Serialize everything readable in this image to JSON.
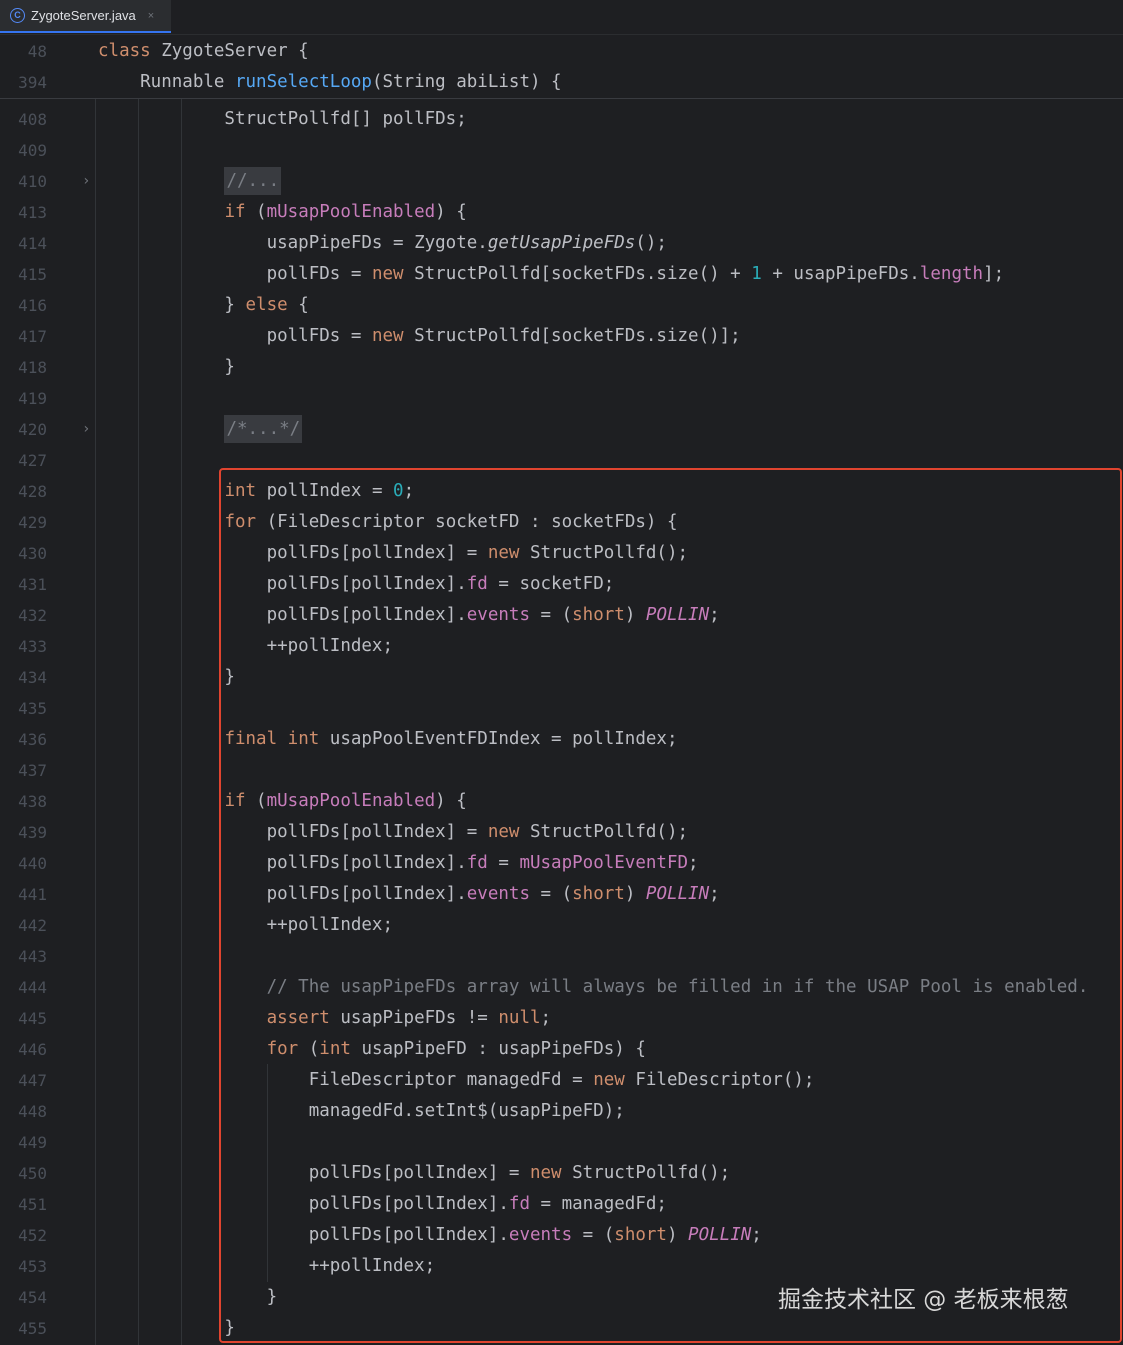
{
  "tab": {
    "icon": "C",
    "title": "ZygoteServer.java",
    "close": "×"
  },
  "sticky": [
    {
      "ln": "48",
      "tokens": [
        {
          "t": "class ",
          "c": "kw"
        },
        {
          "t": "ZygoteServer {"
        }
      ]
    },
    {
      "ln": "394",
      "tokens": [
        {
          "t": "    Runnable "
        },
        {
          "t": "runSelectLoop",
          "c": "fn"
        },
        {
          "t": "(String abiList) {"
        }
      ]
    }
  ],
  "lines": [
    {
      "ln": "408",
      "tokens": [
        {
          "t": "            StructPollfd[] pollFDs;"
        }
      ]
    },
    {
      "ln": "409",
      "tokens": []
    },
    {
      "ln": "410",
      "fold": true,
      "tokens": [
        {
          "t": "            "
        },
        {
          "t": "//...",
          "c": "cm fold-box"
        }
      ]
    },
    {
      "ln": "413",
      "tokens": [
        {
          "t": "            "
        },
        {
          "t": "if ",
          "c": "kw"
        },
        {
          "t": "("
        },
        {
          "t": "mUsapPoolEnabled",
          "c": "fld"
        },
        {
          "t": ") {"
        }
      ]
    },
    {
      "ln": "414",
      "tokens": [
        {
          "t": "                usapPipeFDs = Zygote."
        },
        {
          "t": "getUsapPipeFDs",
          "c": "mi"
        },
        {
          "t": "();"
        }
      ]
    },
    {
      "ln": "415",
      "tokens": [
        {
          "t": "                pollFDs = "
        },
        {
          "t": "new ",
          "c": "kw"
        },
        {
          "t": "StructPollfd[socketFDs.size() + "
        },
        {
          "t": "1",
          "c": "num"
        },
        {
          "t": " + usapPipeFDs."
        },
        {
          "t": "length",
          "c": "fld"
        },
        {
          "t": "];"
        }
      ]
    },
    {
      "ln": "416",
      "tokens": [
        {
          "t": "            } "
        },
        {
          "t": "else ",
          "c": "kw"
        },
        {
          "t": "{"
        }
      ]
    },
    {
      "ln": "417",
      "tokens": [
        {
          "t": "                pollFDs = "
        },
        {
          "t": "new ",
          "c": "kw"
        },
        {
          "t": "StructPollfd[socketFDs.size()];"
        }
      ]
    },
    {
      "ln": "418",
      "tokens": [
        {
          "t": "            }"
        }
      ]
    },
    {
      "ln": "419",
      "tokens": []
    },
    {
      "ln": "420",
      "fold": true,
      "tokens": [
        {
          "t": "            "
        },
        {
          "t": "/*...*/",
          "c": "cm fold-box"
        }
      ]
    },
    {
      "ln": "427",
      "tokens": []
    },
    {
      "ln": "428",
      "tokens": [
        {
          "t": "            "
        },
        {
          "t": "int ",
          "c": "kw"
        },
        {
          "t": "pollIndex = "
        },
        {
          "t": "0",
          "c": "num"
        },
        {
          "t": ";"
        }
      ]
    },
    {
      "ln": "429",
      "tokens": [
        {
          "t": "            "
        },
        {
          "t": "for ",
          "c": "kw"
        },
        {
          "t": "(FileDescriptor socketFD : socketFDs) {"
        }
      ]
    },
    {
      "ln": "430",
      "tokens": [
        {
          "t": "                pollFDs[pollIndex] = "
        },
        {
          "t": "new ",
          "c": "kw"
        },
        {
          "t": "StructPollfd();"
        }
      ]
    },
    {
      "ln": "431",
      "tokens": [
        {
          "t": "                pollFDs[pollIndex]."
        },
        {
          "t": "fd",
          "c": "fld"
        },
        {
          "t": " = socketFD;"
        }
      ]
    },
    {
      "ln": "432",
      "tokens": [
        {
          "t": "                pollFDs[pollIndex]."
        },
        {
          "t": "events",
          "c": "fld"
        },
        {
          "t": " = ("
        },
        {
          "t": "short",
          "c": "kw"
        },
        {
          "t": ") "
        },
        {
          "t": "POLLIN",
          "c": "fldi"
        },
        {
          "t": ";"
        }
      ]
    },
    {
      "ln": "433",
      "tokens": [
        {
          "t": "                ++pollIndex;"
        }
      ]
    },
    {
      "ln": "434",
      "tokens": [
        {
          "t": "            }"
        }
      ]
    },
    {
      "ln": "435",
      "tokens": []
    },
    {
      "ln": "436",
      "tokens": [
        {
          "t": "            "
        },
        {
          "t": "final int ",
          "c": "kw"
        },
        {
          "t": "usapPoolEventFDIndex = pollIndex;"
        }
      ]
    },
    {
      "ln": "437",
      "tokens": []
    },
    {
      "ln": "438",
      "tokens": [
        {
          "t": "            "
        },
        {
          "t": "if ",
          "c": "kw"
        },
        {
          "t": "("
        },
        {
          "t": "mUsapPoolEnabled",
          "c": "fld"
        },
        {
          "t": ") {"
        }
      ]
    },
    {
      "ln": "439",
      "tokens": [
        {
          "t": "                pollFDs[pollIndex] = "
        },
        {
          "t": "new ",
          "c": "kw"
        },
        {
          "t": "StructPollfd();"
        }
      ]
    },
    {
      "ln": "440",
      "tokens": [
        {
          "t": "                pollFDs[pollIndex]."
        },
        {
          "t": "fd",
          "c": "fld"
        },
        {
          "t": " = "
        },
        {
          "t": "mUsapPoolEventFD",
          "c": "fld"
        },
        {
          "t": ";"
        }
      ]
    },
    {
      "ln": "441",
      "tokens": [
        {
          "t": "                pollFDs[pollIndex]."
        },
        {
          "t": "events",
          "c": "fld"
        },
        {
          "t": " = ("
        },
        {
          "t": "short",
          "c": "kw"
        },
        {
          "t": ") "
        },
        {
          "t": "POLLIN",
          "c": "fldi"
        },
        {
          "t": ";"
        }
      ]
    },
    {
      "ln": "442",
      "tokens": [
        {
          "t": "                ++pollIndex;"
        }
      ]
    },
    {
      "ln": "443",
      "tokens": []
    },
    {
      "ln": "444",
      "tokens": [
        {
          "t": "                "
        },
        {
          "t": "// The usapPipeFDs array will always be filled in if the USAP Pool is enabled.",
          "c": "cm"
        }
      ]
    },
    {
      "ln": "445",
      "tokens": [
        {
          "t": "                "
        },
        {
          "t": "assert ",
          "c": "kw"
        },
        {
          "t": "usapPipeFDs != "
        },
        {
          "t": "null",
          "c": "kw"
        },
        {
          "t": ";"
        }
      ]
    },
    {
      "ln": "446",
      "tokens": [
        {
          "t": "                "
        },
        {
          "t": "for ",
          "c": "kw"
        },
        {
          "t": "("
        },
        {
          "t": "int ",
          "c": "kw"
        },
        {
          "t": "usapPipeFD : usapPipeFDs) {"
        }
      ]
    },
    {
      "ln": "447",
      "tokens": [
        {
          "t": "                    FileDescriptor managedFd = "
        },
        {
          "t": "new ",
          "c": "kw"
        },
        {
          "t": "FileDescriptor();"
        }
      ]
    },
    {
      "ln": "448",
      "tokens": [
        {
          "t": "                    managedFd.setInt$(usapPipeFD);"
        }
      ]
    },
    {
      "ln": "449",
      "tokens": []
    },
    {
      "ln": "450",
      "tokens": [
        {
          "t": "                    pollFDs[pollIndex] = "
        },
        {
          "t": "new ",
          "c": "kw"
        },
        {
          "t": "StructPollfd();"
        }
      ]
    },
    {
      "ln": "451",
      "tokens": [
        {
          "t": "                    pollFDs[pollIndex]."
        },
        {
          "t": "fd",
          "c": "fld"
        },
        {
          "t": " = managedFd;"
        }
      ]
    },
    {
      "ln": "452",
      "tokens": [
        {
          "t": "                    pollFDs[pollIndex]."
        },
        {
          "t": "events",
          "c": "fld"
        },
        {
          "t": " = ("
        },
        {
          "t": "short",
          "c": "kw"
        },
        {
          "t": ") "
        },
        {
          "t": "POLLIN",
          "c": "fldi"
        },
        {
          "t": ";"
        }
      ]
    },
    {
      "ln": "453",
      "tokens": [
        {
          "t": "                    ++pollIndex;"
        }
      ]
    },
    {
      "ln": "454",
      "tokens": [
        {
          "t": "                }"
        }
      ]
    },
    {
      "ln": "455",
      "tokens": [
        {
          "t": "            }"
        }
      ]
    }
  ],
  "watermark": "掘金技术社区 @ 老板来根葱"
}
